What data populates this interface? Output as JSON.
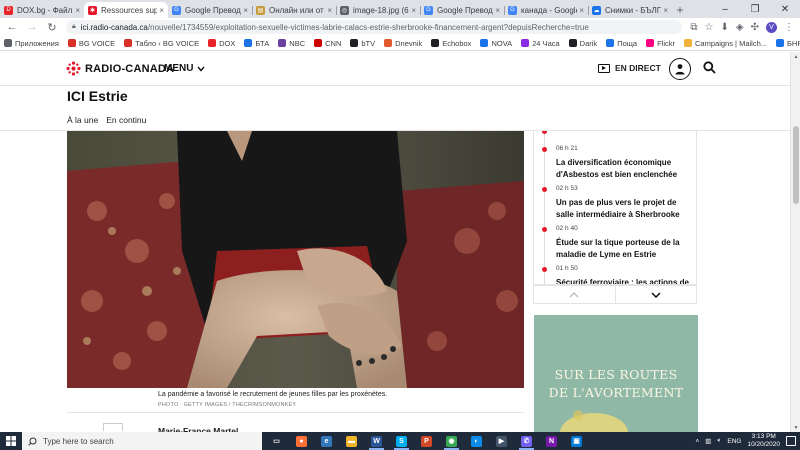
{
  "browser": {
    "tabs": [
      {
        "label": "DOX.bg - Файл с",
        "color": "#e8232a",
        "glyph": "D",
        "active": false
      },
      {
        "label": "Ressources supp",
        "color": "#e5172b",
        "glyph": "✱",
        "active": true
      },
      {
        "label": "Google Преводач",
        "color": "#4285f4",
        "glyph": "G",
        "active": false
      },
      {
        "label": "Онлайн или от в",
        "color": "#c49a3a",
        "glyph": "▤",
        "active": false
      },
      {
        "label": "image-18.jpg (62",
        "color": "#5f6368",
        "glyph": "◎",
        "active": false
      },
      {
        "label": "Google Преводач",
        "color": "#4285f4",
        "glyph": "G",
        "active": false
      },
      {
        "label": "канада - Google",
        "color": "#4285f4",
        "glyph": "G",
        "active": false
      },
      {
        "label": "Снимки - БЪЛГА",
        "color": "#1a73e8",
        "glyph": "☁",
        "active": false
      }
    ],
    "url_host": "ici.radio-canada.ca",
    "url_path": "/nouvelle/1734559/exploitation-sexuelle-victimes-labrie-calacs-estrie-sherbrooke-financement-argent?depuisRecherche=true",
    "profile_initial": "V",
    "bookmarks": [
      {
        "label": "Приложения",
        "color": "#5f6368"
      },
      {
        "label": "BG VOICE",
        "color": "#d93025"
      },
      {
        "label": "Табло ‹ BG VOICE",
        "color": "#d93025"
      },
      {
        "label": "DOX",
        "color": "#e8232a"
      },
      {
        "label": "БТА",
        "color": "#1a73e8"
      },
      {
        "label": "NBC",
        "color": "#6b3fa0"
      },
      {
        "label": "CNN",
        "color": "#cc0000"
      },
      {
        "label": "bTV",
        "color": "#202124"
      },
      {
        "label": "Dnevnik",
        "color": "#e05a2b"
      },
      {
        "label": "Echobox",
        "color": "#202124"
      },
      {
        "label": "NOVA",
        "color": "#1a73e8"
      },
      {
        "label": "24 Часа",
        "color": "#8a2be2"
      },
      {
        "label": "Darik",
        "color": "#202124"
      },
      {
        "label": "Поща",
        "color": "#1a73e8"
      },
      {
        "label": "Flickr",
        "color": "#ff0084"
      },
      {
        "label": "Campaigns | Mailch...",
        "color": "#f2b13a"
      },
      {
        "label": "БНР Новини",
        "color": "#1a73e8"
      }
    ]
  },
  "site": {
    "logo_text": "RADIO-CANADA",
    "menu_label": "MENU",
    "live_label": "EN DIRECT",
    "section_title": "ICI Estrie",
    "subnav": [
      "À la une",
      "En continu"
    ]
  },
  "article": {
    "caption": "La pandémie a favorisé le recrutement de jeunes filles par les proxénètes.",
    "credit": "PHOTO : GETTY IMAGES / THECRIMSONMONKEY",
    "author": "Marie-France Martel"
  },
  "feed": {
    "items": [
      {
        "time": "06 h 21",
        "title": "La diversification économique d'Asbestos est bien enclenchée"
      },
      {
        "time": "02 h 53",
        "title": "Un pas de plus vers le projet de salle intermédiaire à Sherbrooke"
      },
      {
        "time": "02 h 40",
        "title": "Étude sur la tique porteuse de la maladie de Lyme en Estrie"
      },
      {
        "time": "01 h 50",
        "title": "Sécurité ferroviaire : les actions de"
      }
    ]
  },
  "ad": {
    "line1": "Sur les routes",
    "line2": "de l'avortement",
    "bg_color": "#8fb9a6"
  },
  "taskbar": {
    "search_placeholder": "Type here to search",
    "language": "ENG",
    "time": "3:13 PM",
    "date": "10/20/2020",
    "apps": [
      {
        "name": "task-view",
        "color": "#1f2a3a",
        "glyph": "▭",
        "running": false
      },
      {
        "name": "firefox",
        "color": "#ff7139",
        "glyph": "●",
        "running": false
      },
      {
        "name": "edge-legacy",
        "color": "#3277bc",
        "glyph": "e",
        "running": false
      },
      {
        "name": "explorer",
        "color": "#f0b429",
        "glyph": "▬",
        "running": false
      },
      {
        "name": "word",
        "color": "#2b579a",
        "glyph": "W",
        "running": true
      },
      {
        "name": "skype",
        "color": "#00aff0",
        "glyph": "S",
        "running": true
      },
      {
        "name": "powerpoint",
        "color": "#d24726",
        "glyph": "P",
        "running": false
      },
      {
        "name": "chrome",
        "color": "#34a853",
        "glyph": "◉",
        "running": true
      },
      {
        "name": "edge",
        "color": "#0c8ce9",
        "glyph": "◐",
        "running": false
      },
      {
        "name": "media",
        "color": "#44546a",
        "glyph": "▶",
        "running": false
      },
      {
        "name": "viber",
        "color": "#7360f2",
        "glyph": "✆",
        "running": true
      },
      {
        "name": "onenote",
        "color": "#7719aa",
        "glyph": "N",
        "running": false
      },
      {
        "name": "photos",
        "color": "#0078d4",
        "glyph": "▣",
        "running": false
      }
    ]
  }
}
